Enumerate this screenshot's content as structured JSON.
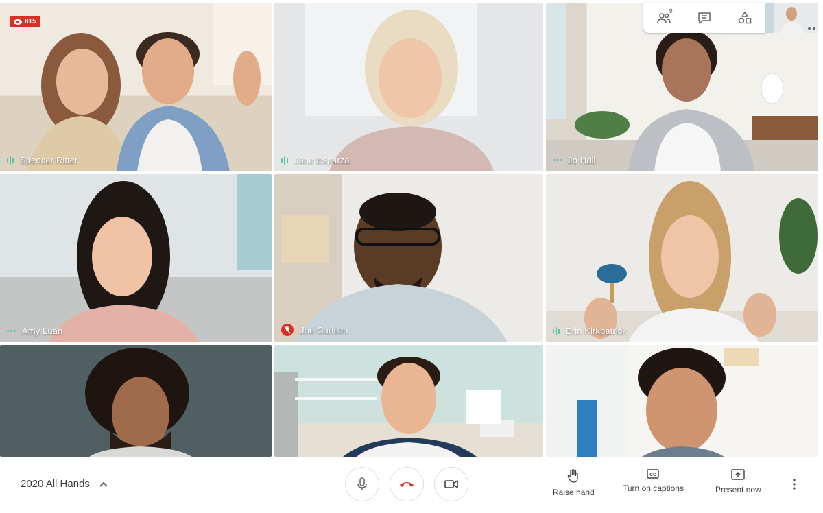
{
  "live": {
    "count": "815"
  },
  "participants": [
    {
      "name": "Spencer Ritter",
      "indicator": "speaking"
    },
    {
      "name": "Jane Esparza",
      "indicator": "speaking"
    },
    {
      "name": "Jo Hall",
      "indicator": "dots"
    },
    {
      "name": "Amy Luan",
      "indicator": "dots"
    },
    {
      "name": "Joe Carlson",
      "indicator": "muted"
    },
    {
      "name": "Erin Kirkpatrick",
      "indicator": "speaking"
    },
    {
      "name": "",
      "indicator": "none"
    },
    {
      "name": "",
      "indicator": "none"
    },
    {
      "name": "",
      "indicator": "none"
    }
  ],
  "top_controls": {
    "people_count": "9",
    "people_icon": "people-icon",
    "chat_icon": "chat-icon",
    "activities_icon": "activities-icon"
  },
  "meeting": {
    "title": "2020 All Hands"
  },
  "actions": {
    "raise_hand": "Raise hand",
    "captions": "Turn on captions",
    "present": "Present now"
  },
  "colors": {
    "accent_red": "#d93025",
    "speaking_green": "#58c8a2",
    "text": "#3c4043"
  }
}
